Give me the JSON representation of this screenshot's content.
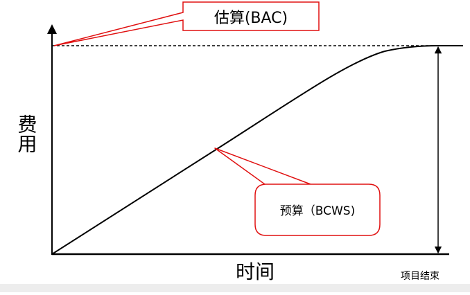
{
  "diagram": {
    "y_axis_label": "费用",
    "x_axis_label": "时间",
    "end_label": "项目结束",
    "callouts": {
      "bac": {
        "text": "估算(BAC)"
      },
      "bcws": {
        "text": "预算（BCWS)"
      }
    },
    "colors": {
      "axis": "#000000",
      "curve": "#000000",
      "callout_border": "#e01010",
      "callout_fill": "#ffffff"
    }
  }
}
